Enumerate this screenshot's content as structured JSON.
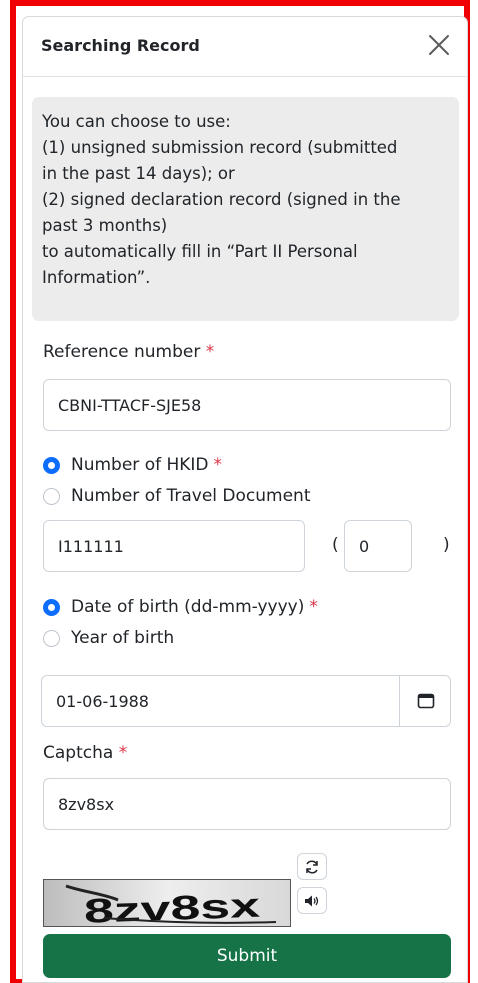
{
  "dialog": {
    "title": "Searching Record"
  },
  "info": {
    "lines": [
      "You can choose to use:",
      "(1) unsigned submission record (submitted",
      "in the past 14 days); or",
      "(2) signed declaration record (signed in the",
      "past 3 months)",
      "to automatically fill in “Part II Personal",
      "Information”."
    ]
  },
  "reference": {
    "label": "Reference number",
    "required_mark": "*",
    "value": "CBNI-TTACF-SJE58"
  },
  "id_type": {
    "options": [
      {
        "label": "Number of HKID",
        "required_mark": "*",
        "checked": true
      },
      {
        "label": "Number of Travel Document",
        "required_mark": "",
        "checked": false
      }
    ],
    "id_value": "I111111",
    "paren_open": "(",
    "check_digit": "0",
    "paren_close": ")"
  },
  "birth_type": {
    "options": [
      {
        "label": "Date of birth (dd-mm-yyyy)",
        "required_mark": "*",
        "checked": true
      },
      {
        "label": "Year of birth",
        "required_mark": "",
        "checked": false
      }
    ],
    "date_value": "01-06-1988"
  },
  "captcha": {
    "label": "Captcha",
    "required_mark": "*",
    "value": "8zv8sx",
    "image_text": "8zv8sx"
  },
  "icons": {
    "close": "close-icon",
    "calendar": "calendar-icon",
    "refresh": "refresh-icon",
    "audio": "speaker-icon"
  },
  "submit": {
    "label": "Submit"
  },
  "colors": {
    "frame": "#f00000",
    "primary": "#0d6efd",
    "submit": "#157347",
    "required": "#dc3545",
    "info_bg": "#ececec"
  }
}
